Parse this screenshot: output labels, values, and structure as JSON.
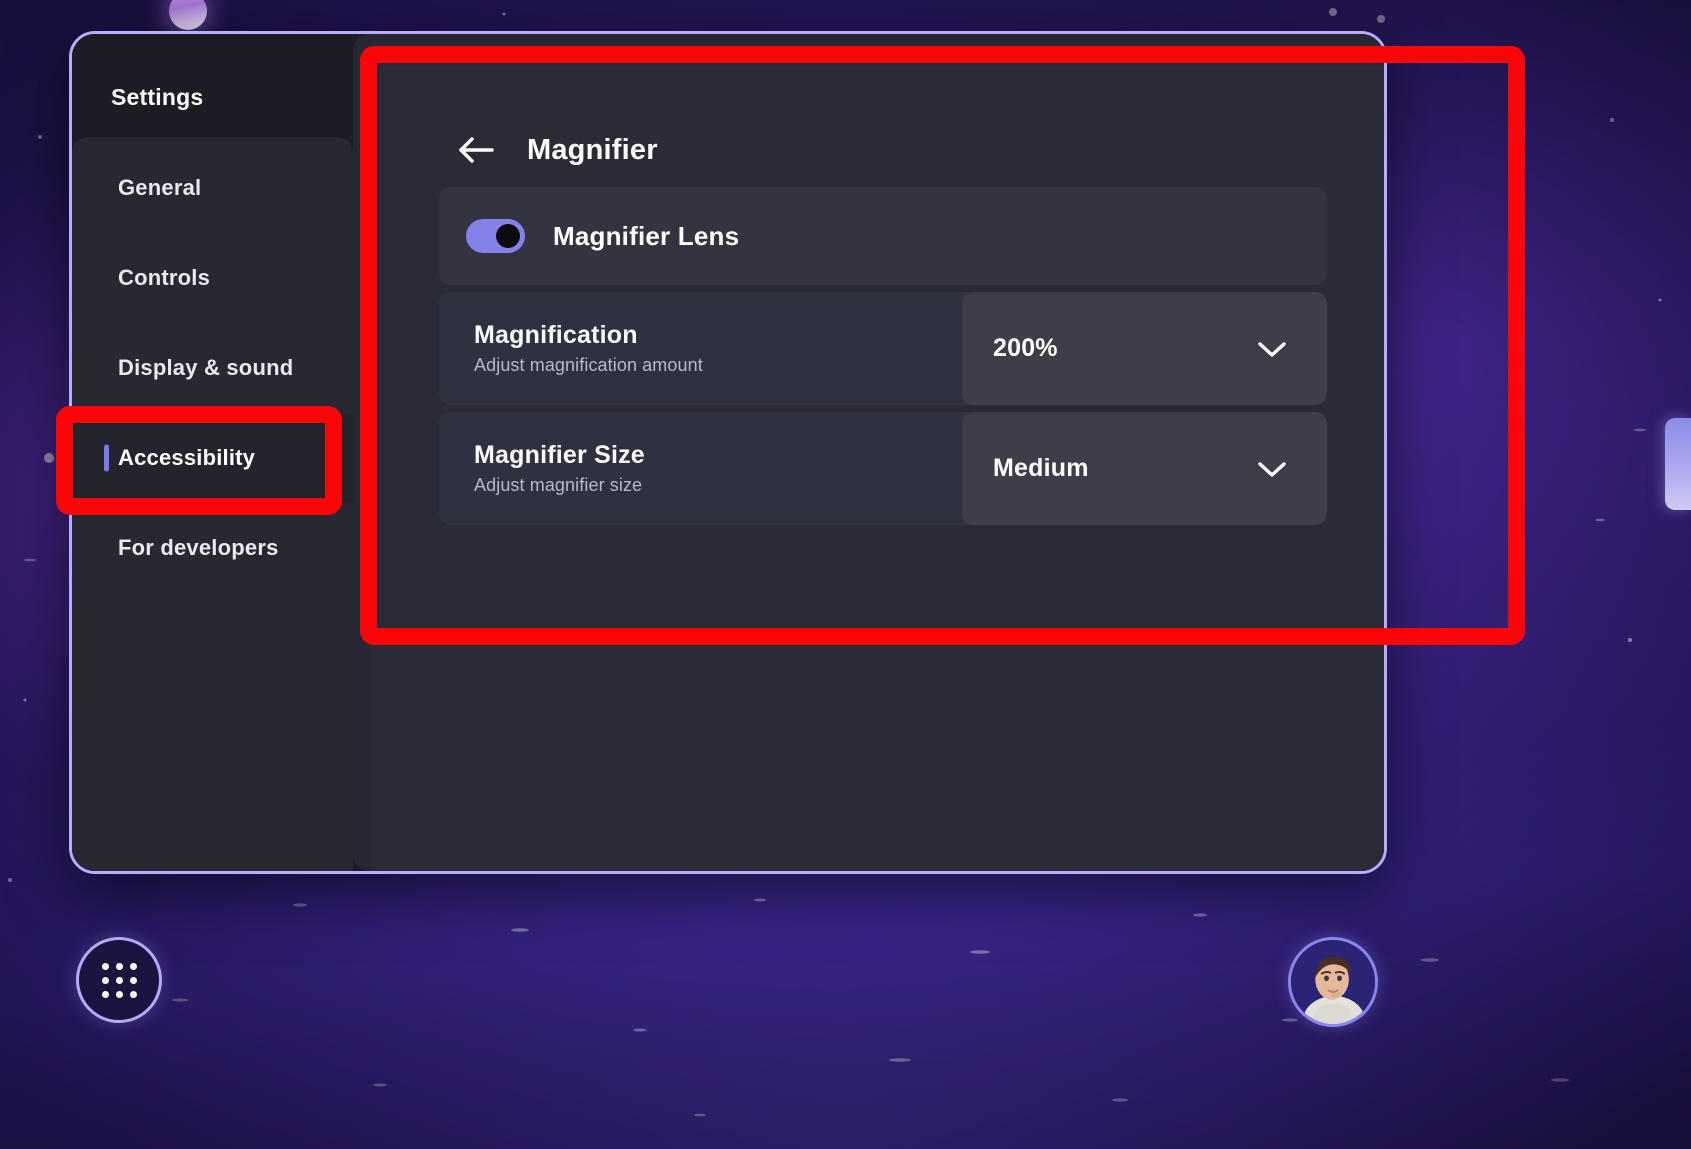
{
  "window": {
    "sidebar_title": "Settings",
    "nav_items": [
      {
        "label": "General",
        "active": false
      },
      {
        "label": "Controls",
        "active": false
      },
      {
        "label": "Display & sound",
        "active": false
      },
      {
        "label": "Accessibility",
        "active": true
      },
      {
        "label": "For developers",
        "active": false
      }
    ]
  },
  "page": {
    "back_icon": "arrow-left-icon",
    "title": "Magnifier",
    "toggle_row": {
      "label": "Magnifier Lens",
      "state": "on"
    },
    "settings": [
      {
        "label": "Magnification",
        "sublabel": "Adjust magnification amount",
        "value": "200%",
        "chevron": "chevron-down-icon"
      },
      {
        "label": "Magnifier Size",
        "sublabel": "Adjust magnifier size",
        "value": "Medium",
        "chevron": "chevron-down-icon"
      }
    ]
  },
  "taskbar": {
    "apps_button_icon": "app-grid-icon",
    "avatar_icon": "user-avatar-icon"
  },
  "colors": {
    "accent": "#8482ea",
    "annotation": "#fb0606",
    "window_border": "#b6aefb",
    "panel": "#2a2b36",
    "row": "#33343f"
  }
}
